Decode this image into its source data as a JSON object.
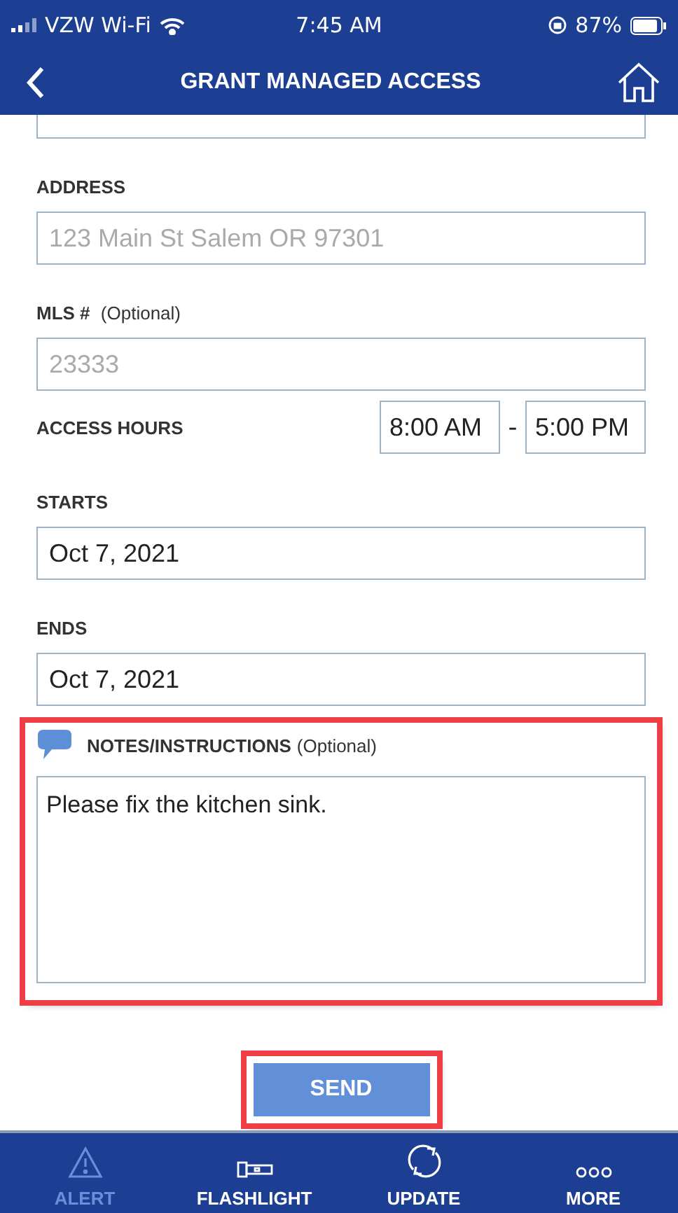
{
  "status_bar": {
    "carrier": "VZW Wi-Fi",
    "time": "7:45 AM",
    "battery": "87%"
  },
  "header": {
    "title": "GRANT MANAGED ACCESS"
  },
  "fields": [
    {
      "kind": "text",
      "label": "ADDRESS",
      "placeholder": "123 Main St Salem OR 97301"
    },
    {
      "kind": "text",
      "label": "MLS #",
      "note": "(Optional)",
      "placeholder": "23333"
    },
    {
      "kind": "range",
      "label": "ACCESS HOURS",
      "from": "8:00 AM",
      "separator": "-",
      "to": "5:00 PM"
    },
    {
      "kind": "text",
      "label": "STARTS",
      "value": "Oct 7, 2021"
    },
    {
      "kind": "text",
      "label": "ENDS",
      "value": "Oct 7, 2021"
    }
  ],
  "notes": {
    "label": "NOTES/INSTRUCTIONS",
    "note": "(Optional)",
    "value": "Please fix the kitchen sink.",
    "highlighted": true
  },
  "send_button": {
    "label": "SEND",
    "highlighted": true
  },
  "tab_bar": [
    {
      "kind": "alert",
      "label": "ALERT",
      "selected": true
    },
    {
      "kind": "flashlight",
      "label": "FLASHLIGHT",
      "selected": false
    },
    {
      "kind": "update",
      "label": "UPDATE",
      "selected": false
    },
    {
      "kind": "more",
      "label": "MORE",
      "selected": false
    }
  ]
}
